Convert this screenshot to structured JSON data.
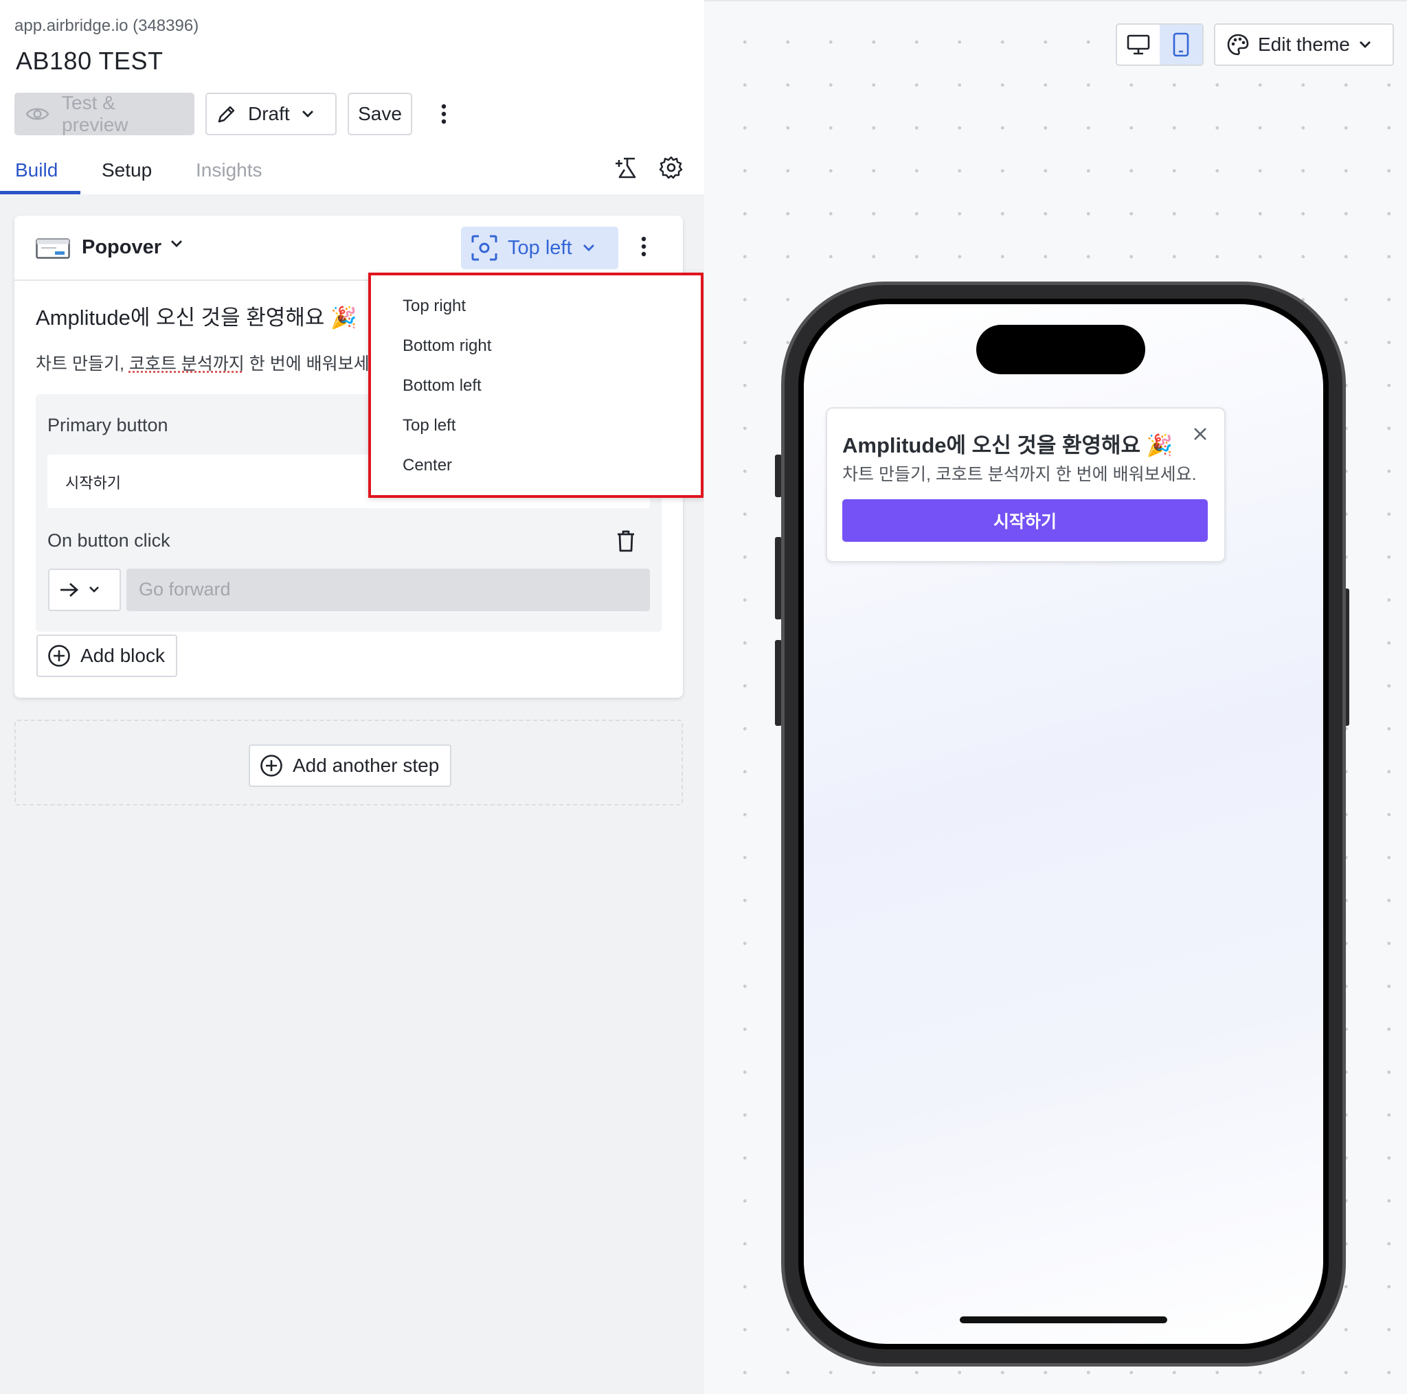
{
  "header": {
    "app_url": "app.airbridge.io (348396)",
    "app_title": "AB180 TEST"
  },
  "toolbar": {
    "preview_label": "Test & preview",
    "draft_label": "Draft",
    "save_label": "Save"
  },
  "tabs": [
    {
      "label": "Build",
      "active": true
    },
    {
      "label": "Setup",
      "active": false
    },
    {
      "label": "Insights",
      "active": false,
      "disabled": true
    }
  ],
  "step": {
    "type_label": "Popover",
    "position_label": "Top left",
    "message_title": "Amplitude에 오신 것을 환영해요 🎉",
    "message_body_prefix": "차트 만들기, ",
    "message_body_underlined": "코호트 분석까지",
    "message_body_suffix": " 한 번에 배워보세요.",
    "primary_button_label": "Primary button",
    "primary_button_value": "시작하기",
    "on_click_label": "On button click",
    "action_placeholder": "Go forward",
    "add_block_label": "Add block"
  },
  "add_step_label": "Add another step",
  "position_dropdown": {
    "options": [
      "Top right",
      "Bottom right",
      "Bottom left",
      "Top left",
      "Center"
    ],
    "highlight_color": "#e0141e"
  },
  "preview": {
    "device_options": [
      "desktop",
      "mobile"
    ],
    "selected_device": "mobile",
    "edit_theme_label": "Edit theme",
    "popover_title": "Amplitude에 오신 것을 환영해요 🎉",
    "popover_body": "차트 만들기, 코호트 분석까지 한 번에 배워보세요.",
    "popover_cta": "시작하기",
    "cta_color": "#7452f5"
  },
  "colors": {
    "accent": "#2b55c7",
    "accent_light": "#dce6fb"
  }
}
